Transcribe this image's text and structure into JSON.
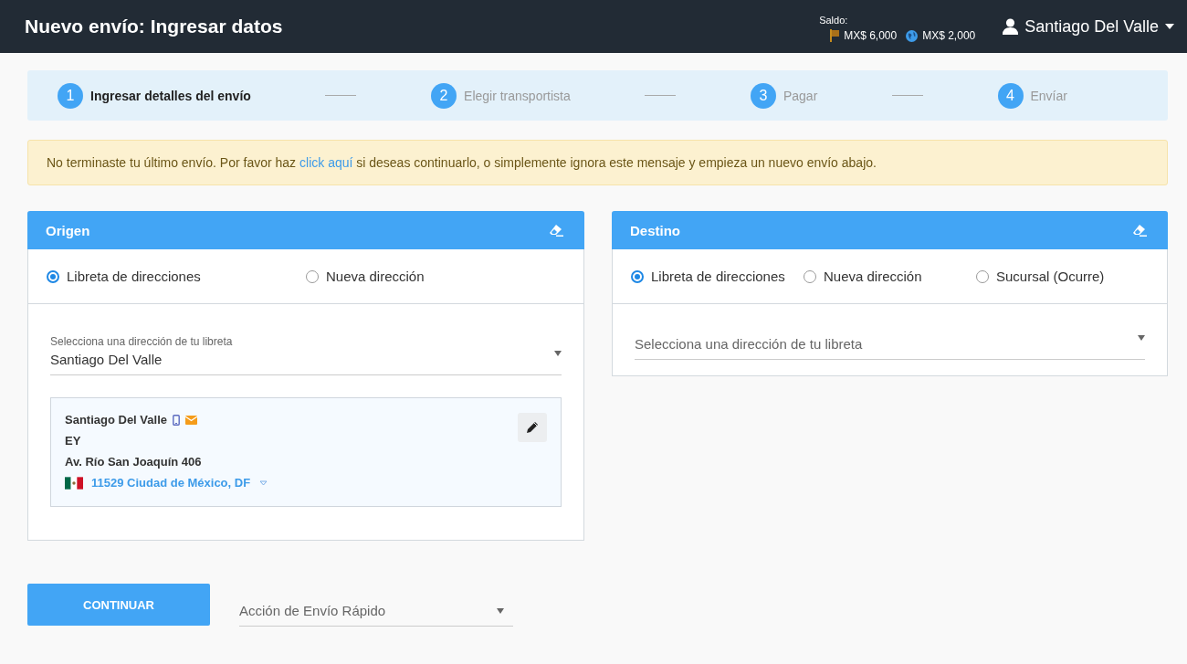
{
  "header": {
    "title": "Nuevo envío: Ingresar datos",
    "balance_label": "Saldo:",
    "balances": [
      {
        "kind": "flag",
        "amount": "MX$ 6,000"
      },
      {
        "kind": "globe",
        "amount": "MX$ 2,000"
      }
    ],
    "user": "Santiago Del Valle"
  },
  "steps": [
    {
      "number": "1",
      "label": "Ingresar detalles del envío",
      "selected": true
    },
    {
      "number": "2",
      "label": "Elegir transportista",
      "selected": false
    },
    {
      "number": "3",
      "label": "Pagar",
      "selected": false
    },
    {
      "number": "4",
      "label": "Envíar",
      "selected": false
    }
  ],
  "alert": {
    "text_before": "No terminaste tu último envío. Por favor haz",
    "link": "click aquí",
    "text_after": "si deseas continuarlo, o simplemente ignora este mensaje y empieza un nuevo envío abajo."
  },
  "origin": {
    "title": "Origen",
    "options": [
      {
        "label": "Libreta de direcciones",
        "selected": true
      },
      {
        "label": "Nueva dirección",
        "selected": false
      }
    ],
    "select": {
      "label": "Selecciona una dirección de tu libreta",
      "value": "Santiago Del Valle"
    },
    "card": {
      "name": "Santiago Del Valle",
      "company": "EY",
      "street": "Av. Río San Joaquín 406",
      "city": "11529 Ciudad de México, DF"
    }
  },
  "destination": {
    "title": "Destino",
    "options": [
      {
        "label": "Libreta de direcciones",
        "selected": true
      },
      {
        "label": "Nueva dirección",
        "selected": false
      },
      {
        "label": "Sucursal (Ocurre)",
        "selected": false
      }
    ],
    "select": {
      "placeholder": "Selecciona una dirección de tu libreta"
    }
  },
  "footer": {
    "button": "CONTINUAR",
    "select": {
      "placeholder": "Acción de Envío Rápido"
    }
  }
}
